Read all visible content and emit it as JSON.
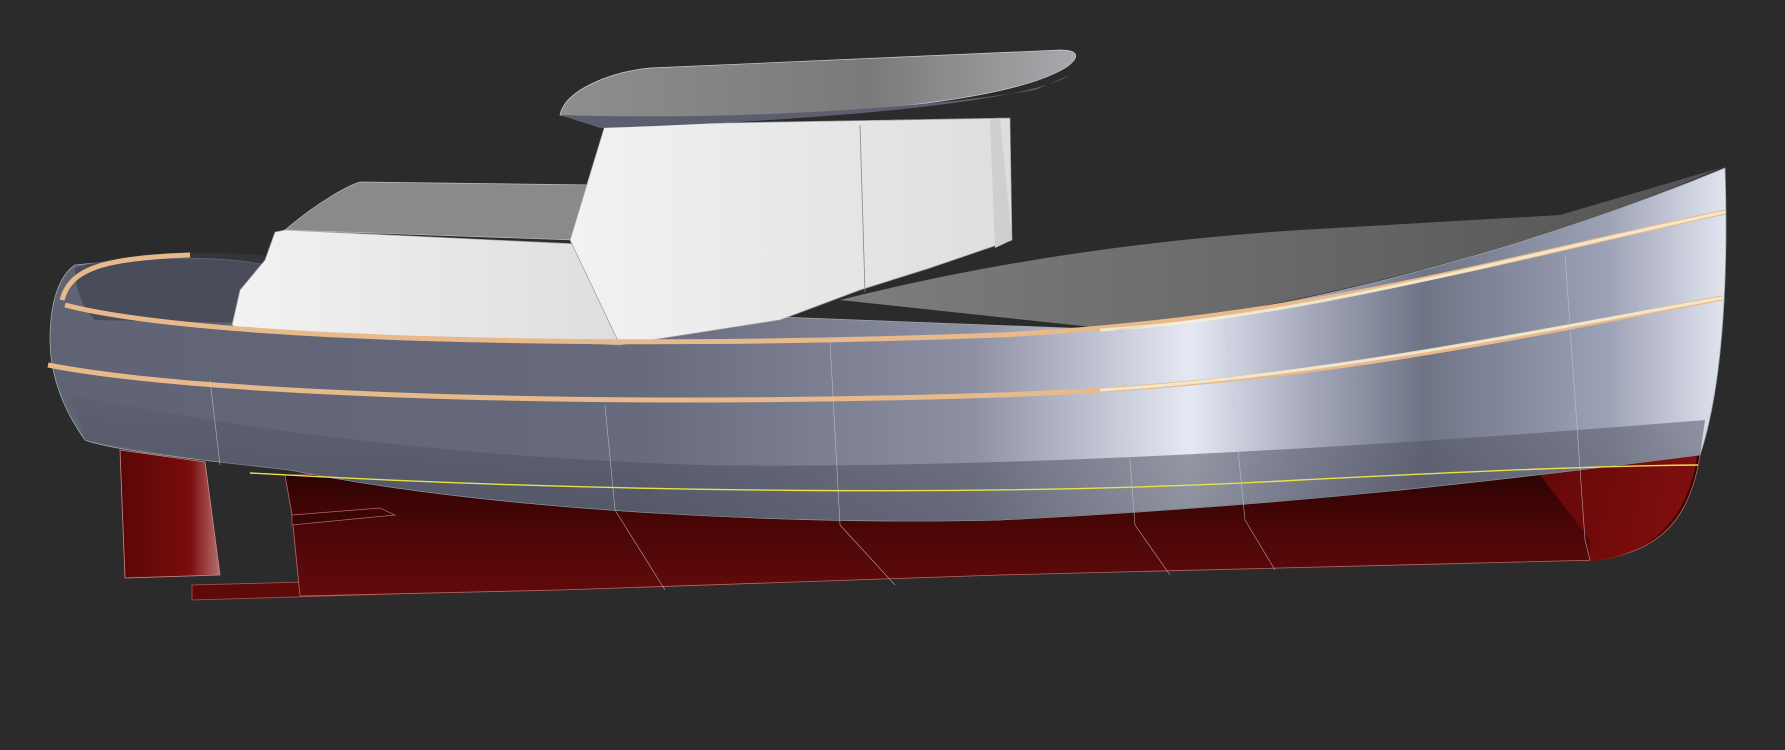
{
  "scene": {
    "subject": "boat-hull-3d-render",
    "background_color": "#2b2b2b",
    "colors": {
      "hull_topsides": "#5b5f70",
      "hull_highlight": "#e8ebf5",
      "bottom_paint": "#5a0808",
      "bottom_shadow": "#2a0303",
      "superstructure": "#e9e9e9",
      "roof": "#8a8a8a",
      "rub_rail": "#e8b98a",
      "waterline": "#e8e24a",
      "panel_lines": "#c8c8d0"
    }
  }
}
